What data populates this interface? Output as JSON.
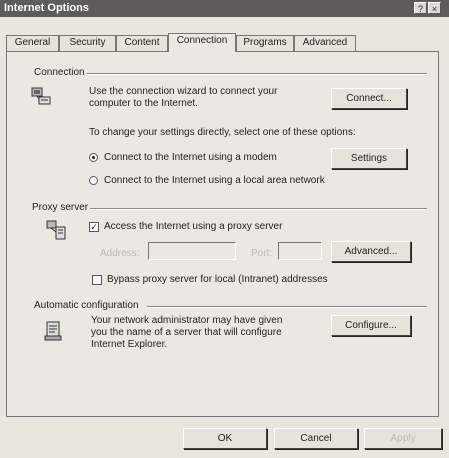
{
  "window": {
    "title": "Internet Options",
    "help_glyph": "?",
    "close_glyph": "×"
  },
  "tabs": [
    {
      "label": "General"
    },
    {
      "label": "Security"
    },
    {
      "label": "Content"
    },
    {
      "label": "Connection"
    },
    {
      "label": "Programs"
    },
    {
      "label": "Advanced"
    }
  ],
  "connection": {
    "group_label": "Connection",
    "description_line1": "Use the connection wizard to connect your",
    "description_line2": "computer to the Internet.",
    "connect_button": "Connect...",
    "change_settings_text": "To change your settings directly, select one of these options:",
    "option_modem": "Connect to the Internet using a modem",
    "option_lan": "Connect to the Internet using a local area network",
    "selected": "modem",
    "settings_button": "Settings"
  },
  "proxy": {
    "group_label": "Proxy server",
    "use_proxy_label": "Access the Internet using a proxy server",
    "use_proxy_checked": true,
    "address_label": "Address:",
    "port_label": "Port:",
    "advanced_button": "Advanced...",
    "bypass_label": "Bypass proxy server for local (Intranet) addresses",
    "bypass_checked": false
  },
  "auto_config": {
    "group_label": "Automatic configuration",
    "description_line1": "Your network administrator may have given",
    "description_line2": "you the name of a server that will configure",
    "description_line3": "Internet Explorer.",
    "configure_button": "Configure..."
  },
  "footer": {
    "ok_button": "OK",
    "cancel_button": "Cancel",
    "apply_button": "Apply"
  },
  "check_glyph": "✓"
}
